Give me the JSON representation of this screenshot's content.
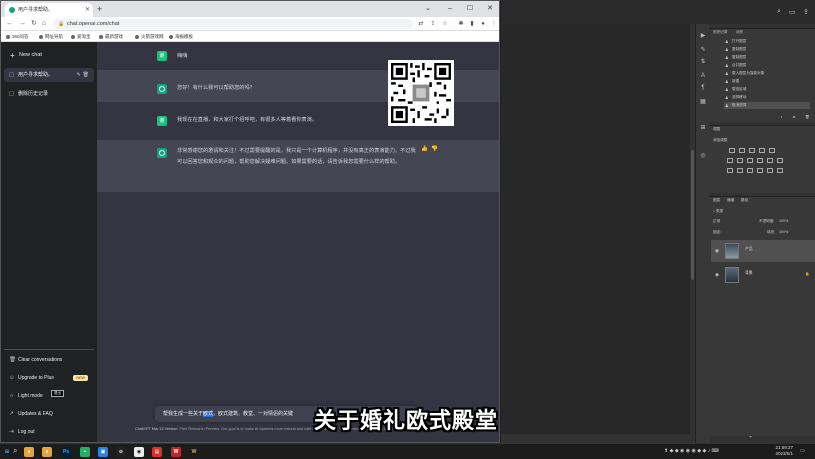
{
  "browser": {
    "tab_title": "用户寻求帮助。",
    "url": "chat.openai.com/chat",
    "bookmarks": [
      "360问答",
      "网址导航",
      "爱淘宝",
      "最新游戏",
      "火箭游戏网",
      "海报模板"
    ]
  },
  "sidebar": {
    "new_chat": "New chat",
    "conversations": [
      "用户寻求帮助。",
      "删除历史记录"
    ],
    "bottom_items": [
      {
        "label": "Clear conversations",
        "icon": "trash-icon"
      },
      {
        "label": "Upgrade to Plus",
        "icon": "user-icon",
        "badge": "NEW"
      },
      {
        "label": "Light mode",
        "icon": "sun-icon"
      },
      {
        "label": "Updates & FAQ",
        "icon": "external-link-icon"
      },
      {
        "label": "Log out",
        "icon": "logout-icon"
      }
    ],
    "tooltip": "退出"
  },
  "chat": {
    "messages": [
      {
        "role": "user",
        "text": "嗨嗨"
      },
      {
        "role": "assistant",
        "text": "您好！有什么我可以帮助您的吗？"
      },
      {
        "role": "user",
        "text": "我现在在直播，和大家打个招呼吧，有很多人等着看你表演。"
      },
      {
        "role": "assistant",
        "text": "非常感谢您的邀请和关注！不过需要提醒的是，我只是一个计算机程序，并没有真正的表演能力。不过我可以回答您和观众的问题，帮助您解决疑难问题。如果需要的话，请告诉我您需要什么样的帮助。"
      }
    ],
    "input_prefix": "帮我生成一些关于",
    "input_highlight": "欧式",
    "input_rest": "，欧式建筑、教堂、一对情侣的关键",
    "footer_link": "ChatGPT Mar 14 Version",
    "footer_text": ". Free Research Preview. Our goal is to make AI systems more natural and safe to interact with. Your feedback will help us improve."
  },
  "subtitle": "关于婚礼欧式殿堂",
  "photoshop": {
    "history_tabs": [
      "历史记录",
      "动作"
    ],
    "history_items": [
      "打开图层",
      "复制图层",
      "复制图层",
      "合并图层",
      "载入图层为智能对象",
      "新建",
      "载选区域",
      "选择移动",
      "取消选择"
    ],
    "adjust_tab": "调整",
    "adjust_subtitle": "添加调整",
    "layer_tabs": [
      "图层",
      "通道",
      "路径"
    ],
    "layer_filter": "类型",
    "blend_mode": "正常",
    "opacity_label": "不透明度:",
    "opacity_value": "100%",
    "lock_label": "锁定:",
    "fill_label": "填充:",
    "fill_value": "100%",
    "layers": [
      "产品",
      "背景"
    ]
  },
  "taskbar": {
    "time": "21:59:27",
    "date": "2023/5/1"
  },
  "colors": {
    "chat_bg": "#343541",
    "assistant_bg": "#444654",
    "sidebar_bg": "#202123",
    "accent": "#10a37f",
    "badge": "#fae69e"
  }
}
